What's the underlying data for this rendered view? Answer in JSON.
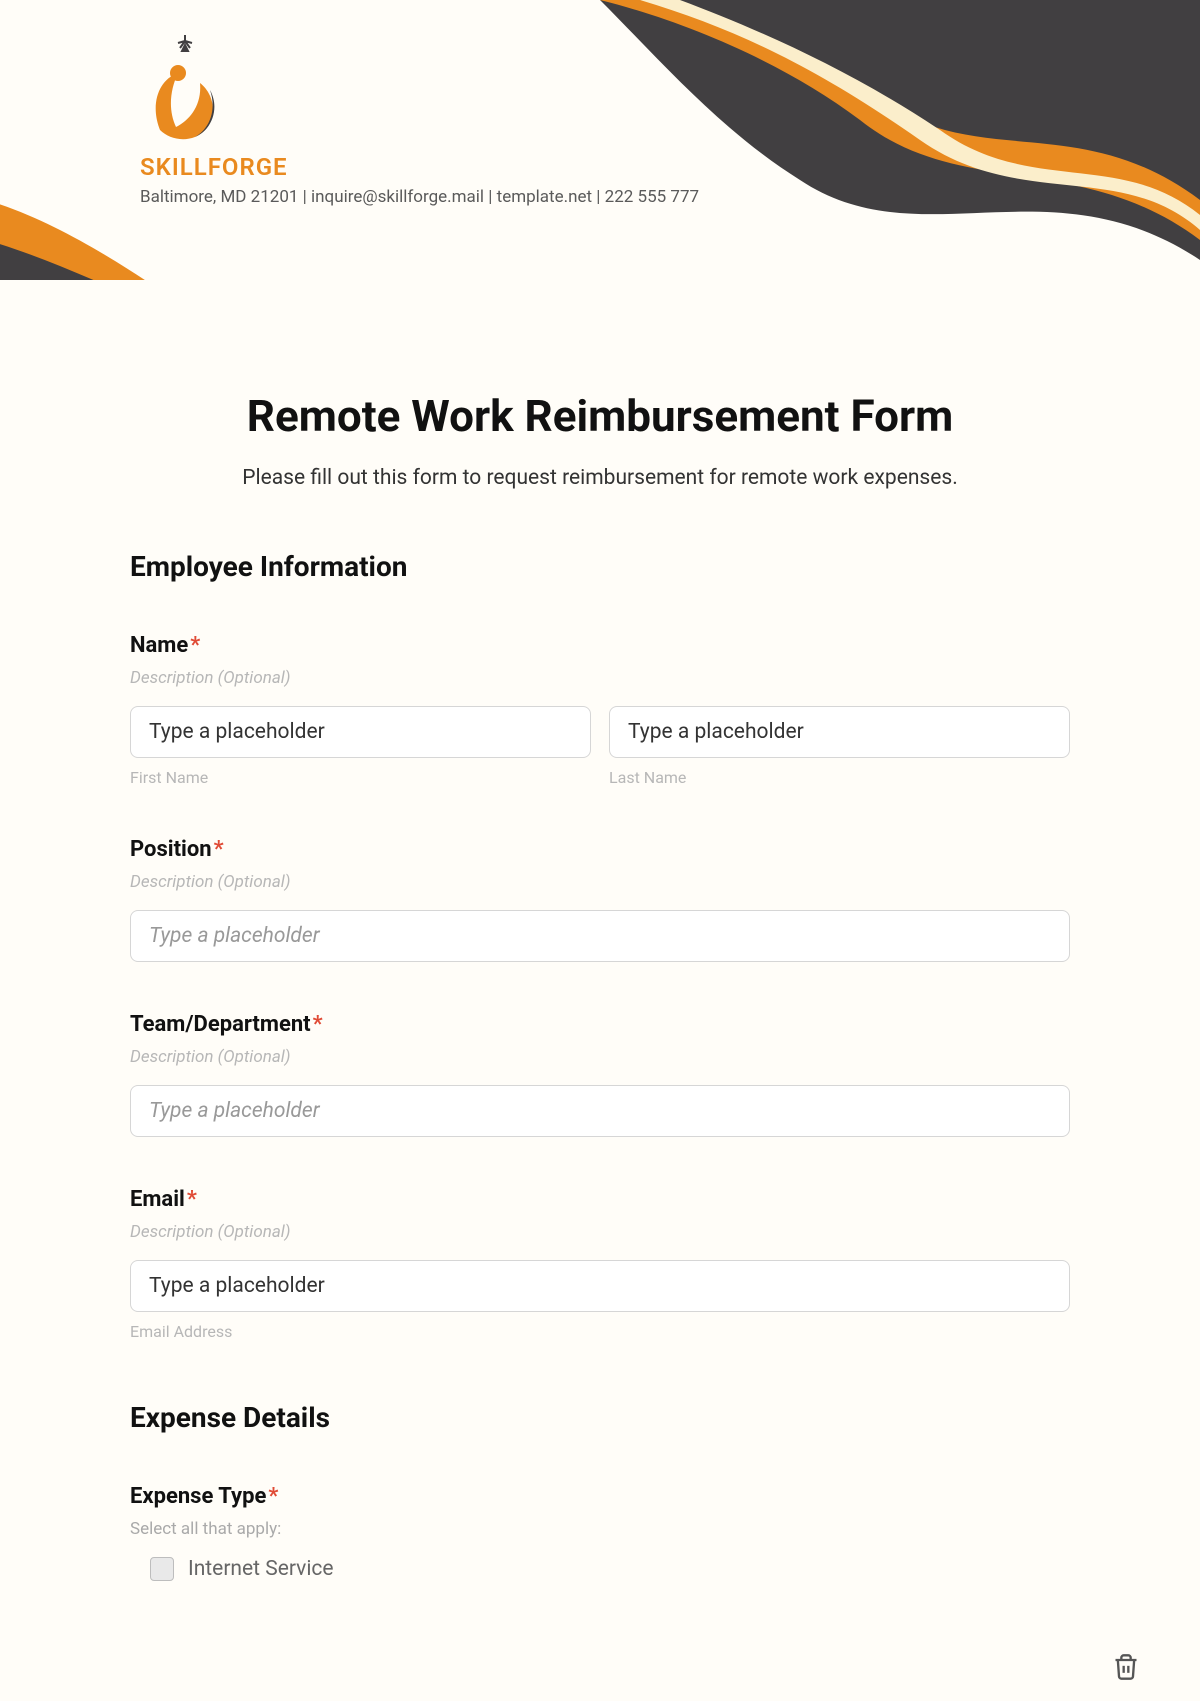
{
  "brand": {
    "name": "SKILLFORGE",
    "sub": "Baltimore, MD 21201 | inquire@skillforge.mail | template.net | 222 555 777"
  },
  "form": {
    "title": "Remote Work Reimbursement Form",
    "subtitle": "Please fill out this form to request reimbursement for remote work expenses."
  },
  "sections": {
    "employee": "Employee Information",
    "expense": "Expense Details"
  },
  "fields": {
    "name": {
      "label": "Name",
      "desc": "Description (Optional)",
      "first_ph": "Type a placeholder",
      "last_ph": "Type a placeholder",
      "first_sub": "First Name",
      "last_sub": "Last Name"
    },
    "position": {
      "label": "Position",
      "desc": "Description (Optional)",
      "ph": "Type a placeholder"
    },
    "team": {
      "label": "Team/Department",
      "desc": "Description (Optional)",
      "ph": "Type a placeholder"
    },
    "email": {
      "label": "Email",
      "desc": "Description (Optional)",
      "ph": "Type a placeholder",
      "sub": "Email Address"
    },
    "expense_type": {
      "label": "Expense Type",
      "hint": "Select all that apply:",
      "opt1": "Internet Service"
    }
  },
  "required_mark": "*"
}
